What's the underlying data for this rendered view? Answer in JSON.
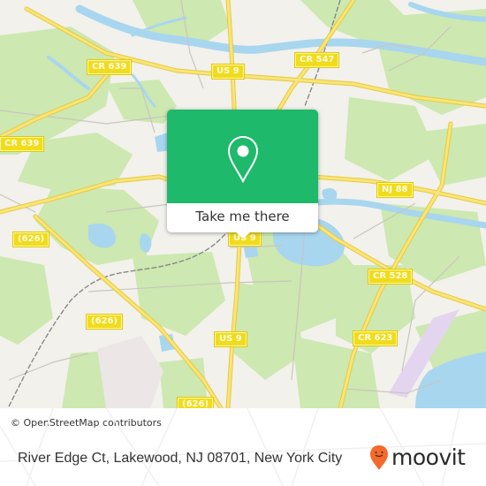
{
  "map": {
    "colors": {
      "land": "#f2f1ec",
      "forest": "#cde8b0",
      "water": "#a8d6ef",
      "road_major": "#f5dc50",
      "road_minor": "#c9c6c0",
      "railway": "#888888",
      "airfield": "#e3d5ef",
      "urban": "#ece6e6"
    },
    "road_labels": [
      {
        "id": "cr639-top",
        "text": "CR 639"
      },
      {
        "id": "us9-top",
        "text": "US 9"
      },
      {
        "id": "cr547",
        "text": "CR 547"
      },
      {
        "id": "cr639-left",
        "text": "CR 639"
      },
      {
        "id": "nj88",
        "text": "NJ 88"
      },
      {
        "id": "r626-left",
        "text": "(626)"
      },
      {
        "id": "us9-center",
        "text": "US 9"
      },
      {
        "id": "cr528",
        "text": "CR 528"
      },
      {
        "id": "r626-mid",
        "text": "(626)"
      },
      {
        "id": "us9-lower",
        "text": "US 9"
      },
      {
        "id": "cr623",
        "text": "CR 623"
      },
      {
        "id": "r626-bottom",
        "text": "(626)"
      }
    ],
    "attribution": "© OpenStreetMap contributors"
  },
  "popup": {
    "icon": "map-pin-icon",
    "button_label": "Take me there",
    "accent_color": "#1eb96b"
  },
  "footer": {
    "address": "River Edge Ct, Lakewood, NJ 08701, New York City",
    "brand": "moovit",
    "brand_color": "#f26b2c"
  }
}
